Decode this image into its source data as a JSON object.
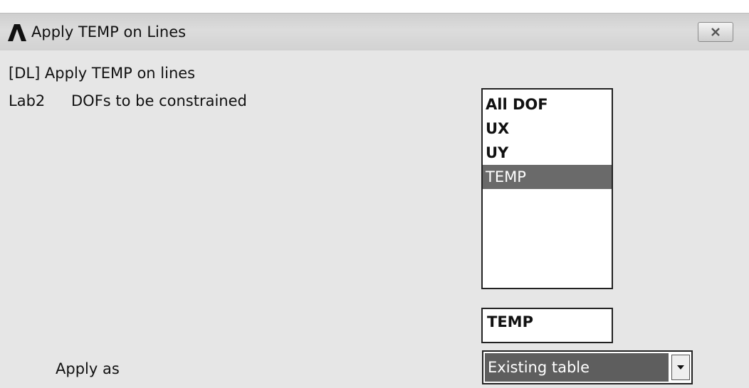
{
  "window": {
    "title": "Apply TEMP on Lines"
  },
  "dialog": {
    "header": "[DL]  Apply TEMP on lines",
    "lab2_key": "Lab2",
    "lab2_desc": "DOFs to be constrained",
    "dof_options": [
      "All DOF",
      "UX",
      "UY",
      "TEMP"
    ],
    "selected_dof": "TEMP",
    "dof_value": "TEMP",
    "apply_as_label": "Apply as",
    "apply_as_value": "Existing table"
  },
  "icons": {
    "logo": "ansys-logo-icon",
    "close": "close-icon",
    "dropdown": "chevron-down-icon"
  },
  "colors": {
    "selection": "#6a6a6a",
    "dialog_bg": "#e6e6e6"
  }
}
